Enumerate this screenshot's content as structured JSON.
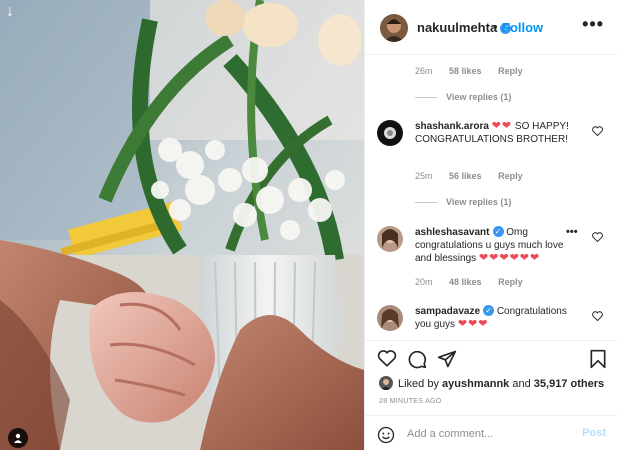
{
  "post": {
    "author": "nakuulmehta",
    "follow_label": "Follow",
    "separator": "•"
  },
  "comments": [
    {
      "meta": {
        "time": "26m",
        "likes": "58 likes",
        "reply": "Reply"
      },
      "view_replies": "View replies (1)"
    },
    {
      "username": "shashank.arora",
      "hearts": "❤❤",
      "text": " SO HAPPY! CONGRATULATIONS BROTHER!",
      "meta": {
        "time": "25m",
        "likes": "56 likes",
        "reply": "Reply"
      },
      "view_replies": "View replies (1)"
    },
    {
      "username": "ashleshasavant",
      "text": " Omg congratulations u guys much love and blessings ",
      "hearts": "❤❤❤❤❤❤",
      "meta": {
        "time": "20m",
        "likes": "48 likes",
        "reply": "Reply"
      }
    },
    {
      "username": "sampadavaze",
      "text": " Congratulations you guys ",
      "hearts": "❤❤❤"
    }
  ],
  "likes": {
    "prefix": "Liked by",
    "user": "ayushmannk",
    "connector": "and",
    "count": "35,917 others"
  },
  "timestamp": "28 MINUTES AGO",
  "composer": {
    "placeholder": "Add a comment...",
    "post_label": "Post"
  },
  "icons": {
    "download": "down-arrow-icon",
    "user_tag": "user-tag-icon",
    "verified": "verified-badge-icon",
    "more": "more-options-icon",
    "like": "heart-icon",
    "comment": "comment-icon",
    "share": "share-icon",
    "save": "bookmark-icon",
    "emoji": "emoji-icon"
  },
  "colors": {
    "accent": "#0095f6",
    "heart": "#ed4956",
    "muted": "#8e8e8e",
    "post_disabled": "#b2dffc"
  }
}
